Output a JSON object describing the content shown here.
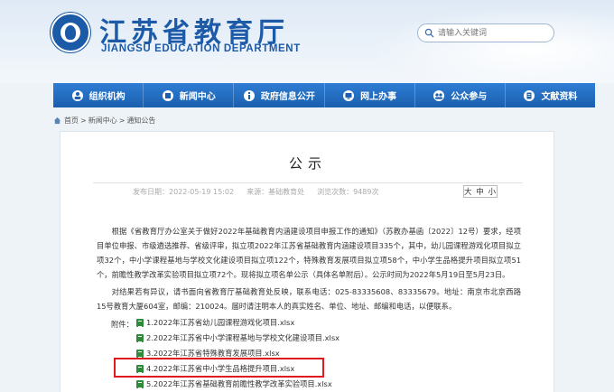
{
  "header": {
    "title": "江苏省教育厅",
    "subtitle": "JIANGSU EDUCATION DEPARTMENT",
    "search_placeholder": "请输入关键词"
  },
  "nav": {
    "items": [
      {
        "label": "组织机构",
        "icon": "org-icon"
      },
      {
        "label": "新闻中心",
        "icon": "news-icon"
      },
      {
        "label": "政府信息公开",
        "icon": "info-icon"
      },
      {
        "label": "网上办事",
        "icon": "service-icon"
      },
      {
        "label": "公众参与",
        "icon": "people-icon"
      },
      {
        "label": "文献资料",
        "icon": "docs-icon"
      }
    ]
  },
  "breadcrumb": {
    "home": "首页",
    "sep": ">",
    "level1": "新闻中心",
    "level2": "通知公告"
  },
  "article": {
    "title": "公示",
    "meta": {
      "date": "发布日期：2022-05-19 15:02",
      "source": "来源：基础教育处",
      "views": "浏览次数：9489次"
    },
    "fontsize": "大 中 小",
    "para1": "根据《省教育厅办公室关于做好2022年基础教育内涵建设项目申报工作的通知》（苏教办基函〔2022〕12号）要求，经项目单位申报、市级遴选推荐、省级评审，拟立项2022年江苏省基础教育内涵建设项目335个，其中，幼儿园课程游戏化项目拟立项32个，中小学课程基地与学校文化建设项目拟立项122个，特殊教育发展项目拟立项58个，中小学生品格提升项目拟立项51个，前瞻性教学改革实验项目拟立项72个。现将拟立项名单公示（具体名单附后）。公示时间为2022年5月19日至5月23日。",
    "para2": "对结果若有异议，请书面向省教育厅基础教育处反映，联系电话：025-83335608、83335679。地址：南京市北京西路15号教育大厦604室，邮编：210024。届时请注明本人的真实姓名、单位、地址、邮编和电话，以便联系。",
    "attach_label": "附件：",
    "attachments": [
      "1.2022年江苏省幼儿园课程游戏化项目.xlsx",
      "2.2022年江苏省中小学课程基地与学校文化建设项目.xlsx",
      "3.2022年江苏省特殊教育发展项目.xlsx",
      "4.2022年江苏省中小学生品格提升项目.xlsx",
      "5.2022年江苏省基础教育前瞻性教学改革实验项目.xlsx"
    ]
  },
  "colors": {
    "brand": "#1d5aa8",
    "nav": "#1b5fae",
    "highlight": "#e0191e",
    "excel": "#2f8a3a"
  }
}
